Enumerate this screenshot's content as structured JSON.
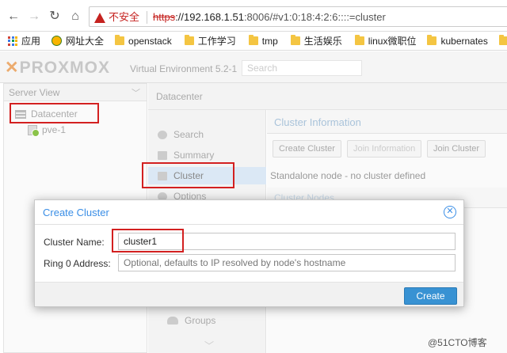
{
  "browser": {
    "security_label": "不安全",
    "url_scheme": "https",
    "url_host": "://192.168.1.51",
    "url_rest": ":8006/#v1:0:18:4:2:6::::=cluster",
    "bookmarks": [
      "应用",
      "网址大全",
      "openstack",
      "工作学习",
      "tmp",
      "生活娱乐",
      "linux微职位",
      "kubernates",
      "投"
    ]
  },
  "header": {
    "logo": "PROXMOX",
    "version": "Virtual Environment 5.2-1",
    "search_placeholder": "Search"
  },
  "tree": {
    "view_label": "Server View",
    "datacenter": "Datacenter",
    "node": "pve-1"
  },
  "content": {
    "title": "Datacenter",
    "menu": [
      "Search",
      "Summary",
      "Cluster",
      "Options"
    ],
    "menu_bottom": "Groups",
    "panel_title": "Cluster Information",
    "buttons": [
      "Create Cluster",
      "Join Information",
      "Join Cluster"
    ],
    "standalone": "Standalone node - no cluster defined",
    "nodes_title": "Cluster Nodes"
  },
  "dialog": {
    "title": "Create Cluster",
    "name_label": "Cluster Name:",
    "name_value": "cluster1",
    "ring_label": "Ring 0 Address:",
    "ring_placeholder": "Optional, defaults to IP resolved by node's hostname",
    "create_label": "Create"
  },
  "watermark": "@51CTO博客"
}
